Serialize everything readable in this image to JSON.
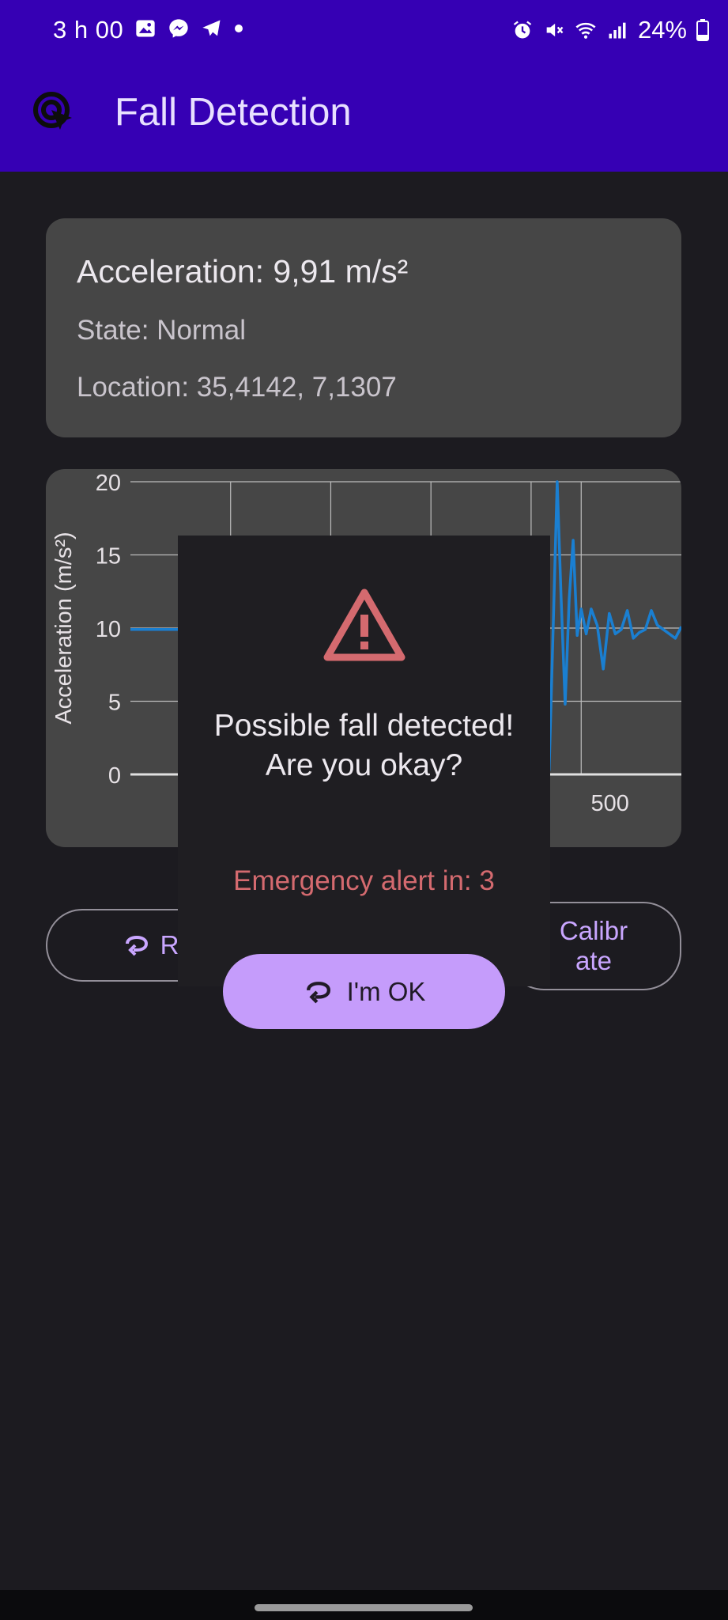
{
  "status_bar": {
    "time": "3 h 00",
    "battery": "24%",
    "left_icons": [
      "gallery-icon",
      "messenger-icon",
      "telegram-icon",
      "dot-icon"
    ],
    "right_icons": [
      "alarm-icon",
      "mute-icon",
      "wifi-icon",
      "signal-icon",
      "battery-icon"
    ]
  },
  "app_bar": {
    "title": "Fall Detection",
    "logo_icon": "tap-target-icon"
  },
  "info": {
    "acceleration": "Acceleration: 9,91 m/s²",
    "state": "State: Normal",
    "location": "Location: 35,4142, 7,1307"
  },
  "chart_data": {
    "type": "line",
    "ylabel": "Acceleration (m/s²)",
    "ylim": [
      0,
      20
    ],
    "yticks": [
      "0",
      "5",
      "10",
      "15",
      "20"
    ],
    "xticks_visible": [
      "500"
    ],
    "xlim": [
      0,
      550
    ],
    "grid": true,
    "series": [
      {
        "color": "#1a7fd1",
        "x": [
          0,
          40,
          80,
          120,
          160,
          200,
          240,
          280,
          320,
          360,
          380,
          390,
          400,
          405,
          410,
          414,
          418,
          422,
          426,
          430,
          434,
          438,
          442,
          446,
          450,
          455,
          460,
          466,
          472,
          478,
          484,
          490,
          496,
          502,
          508,
          514,
          520,
          526,
          532,
          538,
          544,
          550
        ],
        "y": [
          9.9,
          9.9,
          9.9,
          9.9,
          9.9,
          9.9,
          9.9,
          9.9,
          9.9,
          9.9,
          9.9,
          10.0,
          9.8,
          9.9,
          9.0,
          5.0,
          0.3,
          10.0,
          20.0,
          12.0,
          4.8,
          12.0,
          16.0,
          9.5,
          11.3,
          9.6,
          11.3,
          10.2,
          7.2,
          11.0,
          9.6,
          9.9,
          11.2,
          9.3,
          9.7,
          9.9,
          11.2,
          10.2,
          9.9,
          9.6,
          9.3,
          10.1
        ]
      }
    ]
  },
  "buttons": {
    "reset_label": "Res",
    "reset_icon": "reset-icon",
    "calibrate_label": "Calibr\nate"
  },
  "dialog": {
    "icon": "warning-icon",
    "message": "Possible fall detected! Are you okay?",
    "countdown": "Emergency alert in: 3",
    "ok_label": "I'm OK",
    "ok_icon": "reset-icon"
  },
  "colors": {
    "primary": "#3600b4",
    "background": "#1c1b20",
    "card": "#464646",
    "accent": "#c59cfb",
    "warning": "#d46a6f",
    "line": "#1a7fd1"
  }
}
